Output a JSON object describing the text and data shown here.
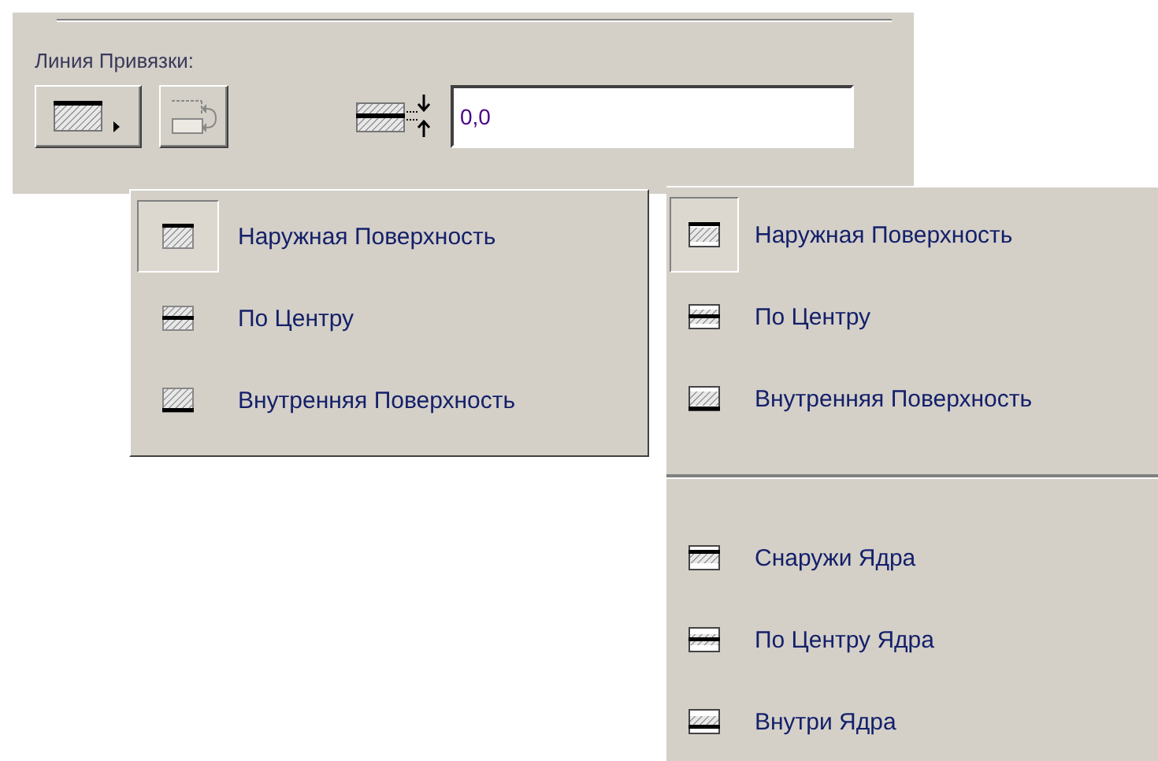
{
  "panel": {
    "label": "Линия Привязки:",
    "offset_field": {
      "value": "0,0"
    }
  },
  "menus": [
    {
      "composite": false,
      "sections": [
        [
          {
            "label": "Наружная Поверхность",
            "kind": "outer",
            "selected": true
          },
          {
            "label": "По Центру",
            "kind": "center",
            "selected": false
          },
          {
            "label": "Внутренняя Поверхность",
            "kind": "inner",
            "selected": false
          }
        ]
      ]
    },
    {
      "composite": true,
      "sections": [
        [
          {
            "label": "Наружная Поверхность",
            "kind": "outer",
            "selected": true
          },
          {
            "label": "По Центру",
            "kind": "center",
            "selected": false
          },
          {
            "label": "Внутренняя Поверхность",
            "kind": "inner",
            "selected": false
          }
        ],
        [
          {
            "label": "Снаружи Ядра",
            "kind": "core-outer",
            "selected": false
          },
          {
            "label": "По Центру Ядра",
            "kind": "core-center",
            "selected": false
          },
          {
            "label": "Внутри Ядра",
            "kind": "core-inner",
            "selected": false
          }
        ]
      ]
    }
  ]
}
